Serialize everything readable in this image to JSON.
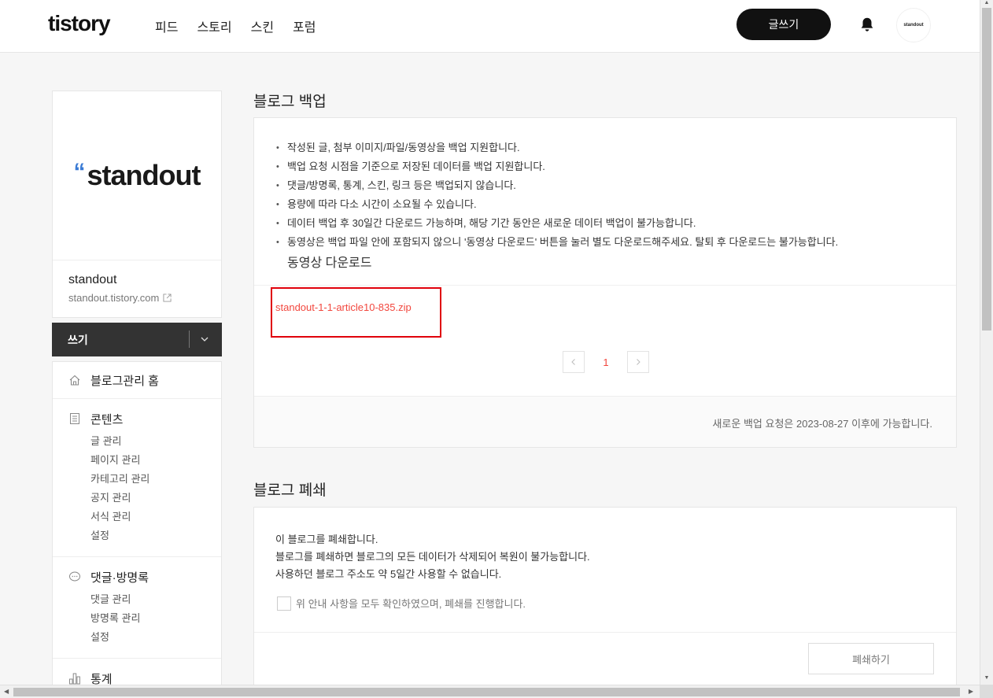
{
  "header": {
    "logo": "tistory",
    "nav": [
      "피드",
      "스토리",
      "스킨",
      "포럼"
    ],
    "write_button": "글쓰기",
    "avatar_text": "standout"
  },
  "sidebar": {
    "thumb_logo": "standout",
    "blog_name": "standout",
    "blog_url": "standout.tistory.com",
    "write_label": "쓰기",
    "home_label": "블로그관리 홈",
    "groups": [
      {
        "title": "콘텐츠",
        "icon": "document-icon",
        "items": [
          "글 관리",
          "페이지 관리",
          "카테고리 관리",
          "공지 관리",
          "서식 관리",
          "설정"
        ]
      },
      {
        "title": "댓글·방명록",
        "icon": "speech-bubble-icon",
        "items": [
          "댓글 관리",
          "방명록 관리",
          "설정"
        ]
      },
      {
        "title": "통계",
        "icon": "bar-chart-icon",
        "items": []
      }
    ]
  },
  "backup": {
    "title": "블로그 백업",
    "notes": [
      "작성된 글, 첨부 이미지/파일/동영상을 백업 지원합니다.",
      "백업 요청 시점을 기준으로 저장된 데이터를 백업 지원합니다.",
      "댓글/방명록, 통계, 스킨, 링크 등은 백업되지 않습니다.",
      "용량에 따라 다소 시간이 소요될 수 있습니다.",
      "데이터 백업 후 30일간 다운로드 가능하며, 해당 기간 동안은 새로운 데이터 백업이 불가능합니다.",
      "동영상은 백업 파일 안에 포함되지 않으니 '동영상 다운로드' 버튼을 눌러 별도 다운로드해주세요. 탈퇴 후 다운로드는 불가능합니다."
    ],
    "video_download_link": "동영상 다운로드",
    "file_name": "standout-1-1-article10-835.zip",
    "current_page": "1",
    "footer_note": "새로운 백업 요청은 2023-08-27 이후에 가능합니다."
  },
  "close": {
    "title": "블로그 폐쇄",
    "lines": [
      "이 블로그를 폐쇄합니다.",
      "블로그를 폐쇄하면 블로그의 모든 데이터가 삭제되어 복원이 불가능합니다.",
      "사용하던 블로그 주소도 약 5일간 사용할 수 없습니다."
    ],
    "agree_label": "위 안내 사항을 모두 확인하였으며, 폐쇄를 진행합니다.",
    "close_button": "폐쇄하기"
  },
  "colors": {
    "accent_red": "#f2473e",
    "highlight_box": "#e0000b",
    "write_bar": "#333333"
  }
}
